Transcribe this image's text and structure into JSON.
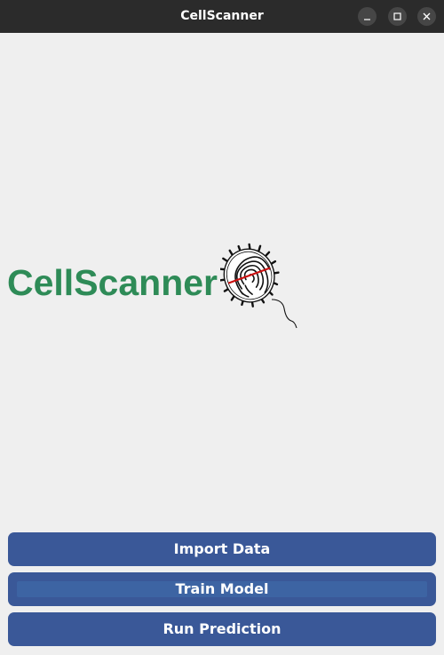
{
  "window": {
    "title": "CellScanner"
  },
  "logo": {
    "text": "CellScanner",
    "icon": "fingerprint-bacterium-icon",
    "color": "#2e8b57"
  },
  "actions": {
    "import_label": "Import Data",
    "train_label": "Train Model",
    "run_label": "Run Prediction"
  },
  "colors": {
    "button": "#3a5898",
    "titlebar": "#2b2b2b",
    "background": "#efefef"
  }
}
